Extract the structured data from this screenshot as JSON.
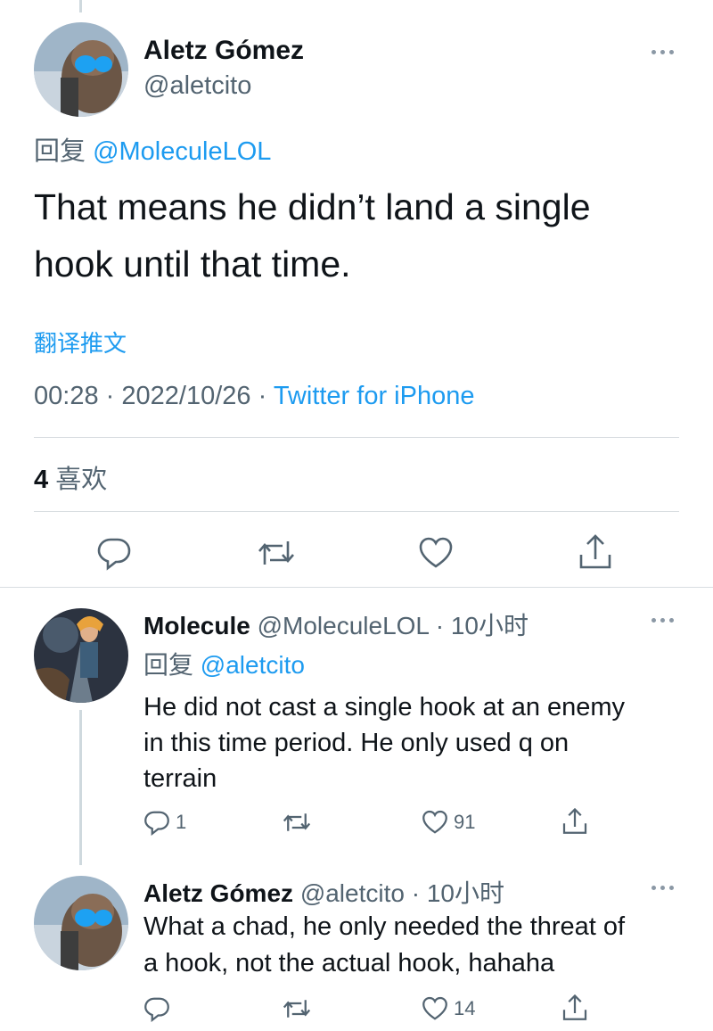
{
  "main_tweet": {
    "author_name": "Aletz Gómez",
    "author_handle": "@aletcito",
    "reply_prefix": "回复",
    "reply_to": "@MoleculeLOL",
    "text_line1": "That means he didn’t land a single",
    "text_line2": "hook until that time.",
    "translate_label": "翻译推文",
    "time": "00:28",
    "sep1": "·",
    "date": "2022/10/26",
    "sep2": "·",
    "source": "Twitter for iPhone",
    "likes_count": "4",
    "likes_label": "喜欢"
  },
  "replies": [
    {
      "author_name": "Molecule",
      "author_handle": "@MoleculeLOL",
      "meta": "· 10小时",
      "reply_prefix": "回复",
      "reply_to": "@aletcito",
      "text_lines": [
        "He did not cast a single hook at an enemy",
        "in this time period. He only used q on",
        "terrain"
      ],
      "reply_count": "1",
      "like_count": "91"
    },
    {
      "author_name": "Aletz Gómez",
      "author_handle": "@aletcito",
      "meta": "· 10小时",
      "text_lines": [
        "What a chad, he only needed the threat of",
        "a hook, not the actual hook, hahaha"
      ],
      "reply_count": "",
      "like_count": "14"
    }
  ],
  "colors": {
    "accent": "#1d9bf0",
    "muted": "#536471",
    "divider": "#d8dde1",
    "thread_line": "#cfd9de"
  },
  "icons": [
    "reply-icon",
    "retweet-icon",
    "like-icon",
    "share-icon",
    "more-icon"
  ]
}
